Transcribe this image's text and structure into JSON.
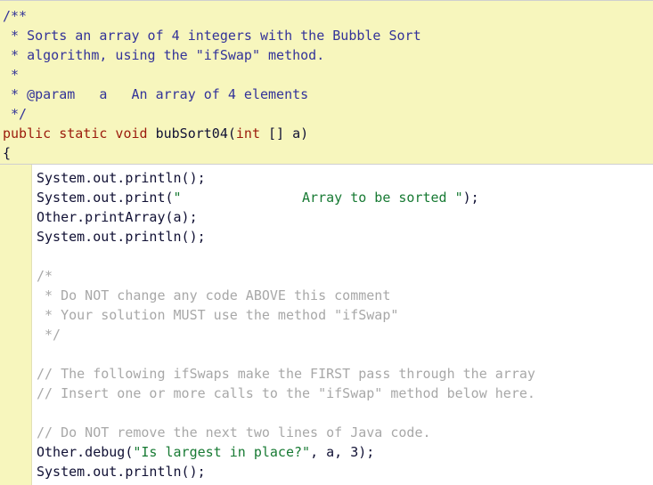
{
  "editor": {
    "name": "java-code-editor",
    "colors": {
      "locked_background": "#f7f6bd",
      "editable_background": "#ffffff",
      "javadoc": "#333399",
      "keyword": "#9b1b0c",
      "string": "#177a33",
      "comment": "#a8a8a8",
      "plain": "#101034"
    }
  },
  "locked_header": {
    "region_name": "uneditable-javadoc-and-signature",
    "lines": [
      [
        {
          "t": "/**",
          "c": "javadoc"
        }
      ],
      [
        {
          "t": " * Sorts an array of 4 integers with the Bubble Sort",
          "c": "javadoc"
        }
      ],
      [
        {
          "t": " * algorithm, using the \"ifSwap\" method.",
          "c": "javadoc"
        }
      ],
      [
        {
          "t": " *",
          "c": "javadoc"
        }
      ],
      [
        {
          "t": " * @param   a   An array of 4 elements",
          "c": "javadoc"
        }
      ],
      [
        {
          "t": " */",
          "c": "javadoc"
        }
      ],
      [
        {
          "t": "public static void ",
          "c": "keyword"
        },
        {
          "t": "bubSort04(",
          "c": "plain"
        },
        {
          "t": "int",
          "c": "type"
        },
        {
          "t": " [] a)",
          "c": "plain"
        }
      ],
      [
        {
          "t": "{",
          "c": "plain"
        }
      ]
    ]
  },
  "code_body": {
    "region_name": "editable-method-body",
    "lines": [
      [
        {
          "t": "System.out.println();",
          "c": "plain"
        }
      ],
      [
        {
          "t": "System.out.print(",
          "c": "plain"
        },
        {
          "t": "\"               Array to be sorted \"",
          "c": "string"
        },
        {
          "t": ");",
          "c": "plain"
        }
      ],
      [
        {
          "t": "Other.printArray(a);",
          "c": "plain"
        }
      ],
      [
        {
          "t": "System.out.println();",
          "c": "plain"
        }
      ],
      [
        {
          "t": "",
          "c": "plain"
        }
      ],
      [
        {
          "t": "/*",
          "c": "comment"
        }
      ],
      [
        {
          "t": " * Do NOT change any code ABOVE this comment",
          "c": "comment"
        }
      ],
      [
        {
          "t": " * Your solution MUST use the method \"ifSwap\"",
          "c": "comment"
        }
      ],
      [
        {
          "t": " */",
          "c": "comment"
        }
      ],
      [
        {
          "t": "",
          "c": "plain"
        }
      ],
      [
        {
          "t": "// The following ifSwaps make the FIRST pass through the array",
          "c": "comment"
        }
      ],
      [
        {
          "t": "// Insert one or more calls to the \"ifSwap\" method below here.",
          "c": "comment"
        }
      ],
      [
        {
          "t": "",
          "c": "plain"
        }
      ],
      [
        {
          "t": "// Do NOT remove the next two lines of Java code.",
          "c": "comment"
        }
      ],
      [
        {
          "t": "Other.debug(",
          "c": "plain"
        },
        {
          "t": "\"Is largest in place?\"",
          "c": "string"
        },
        {
          "t": ", a, 3);",
          "c": "plain"
        }
      ],
      [
        {
          "t": "System.out.println();",
          "c": "plain"
        }
      ]
    ]
  }
}
